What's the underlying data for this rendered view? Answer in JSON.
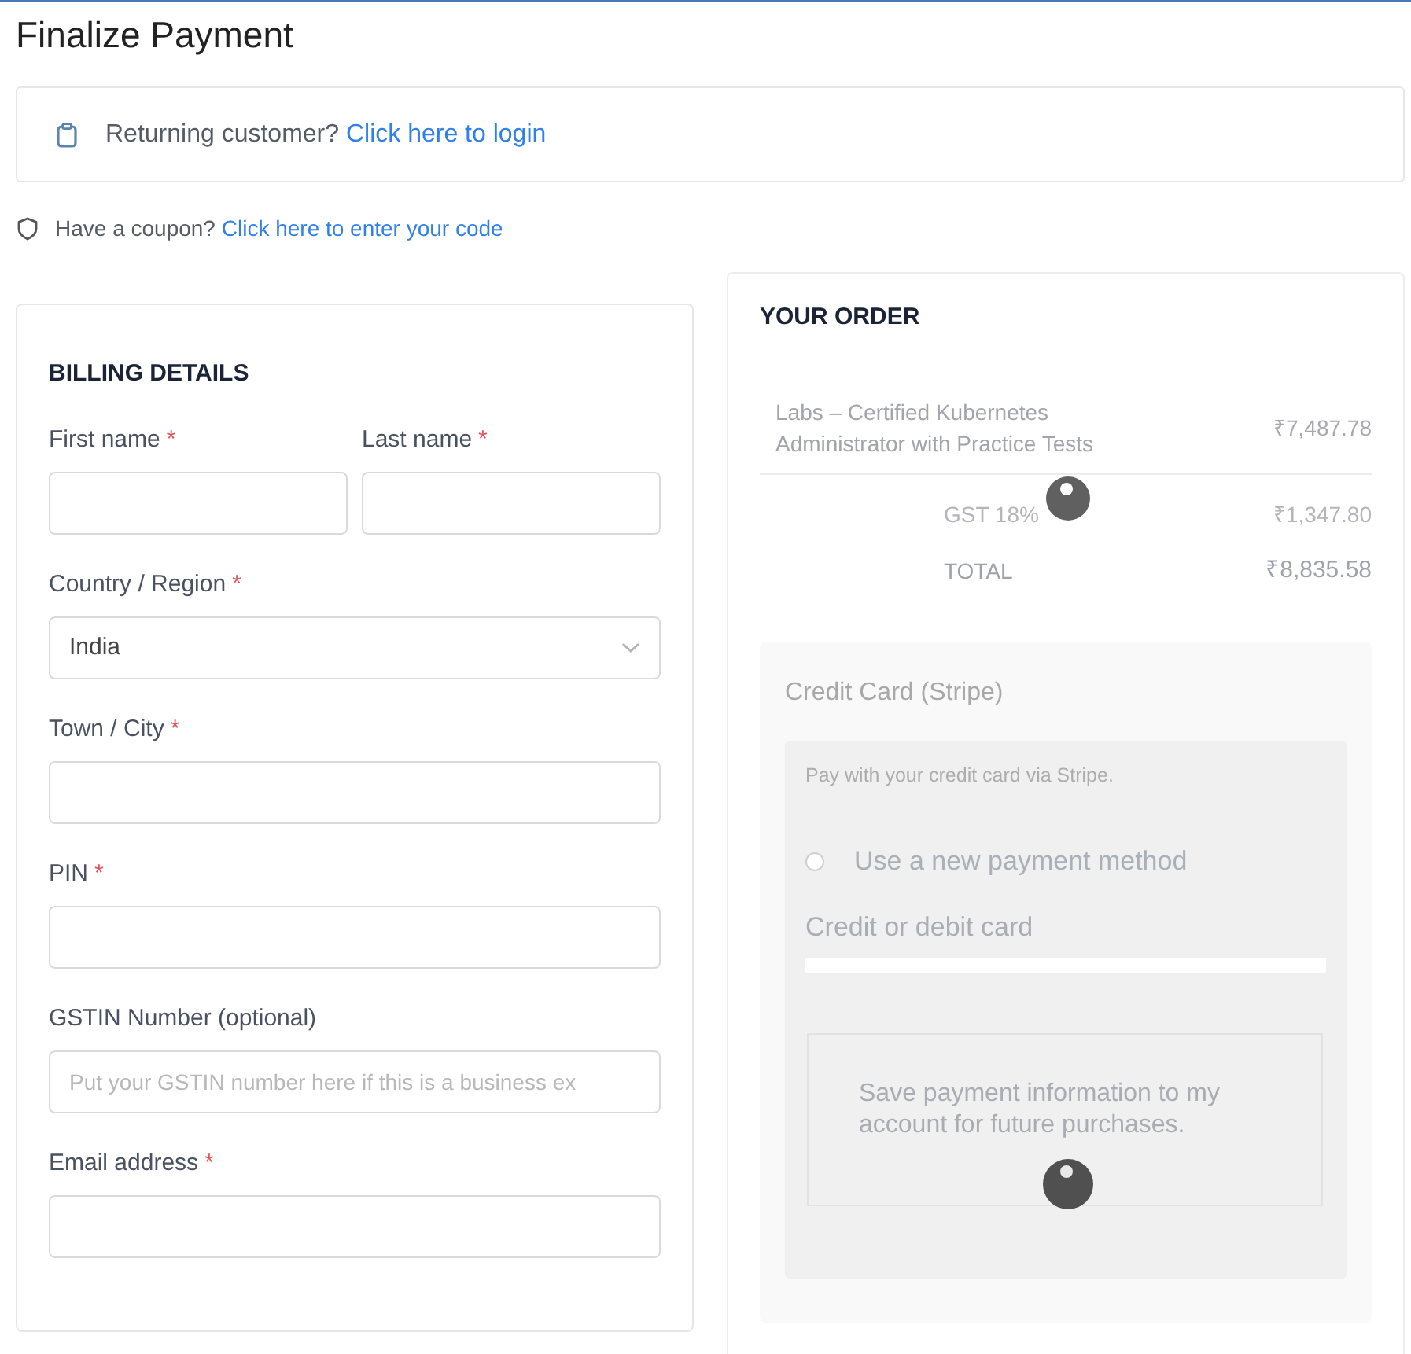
{
  "page": {
    "title": "Finalize Payment"
  },
  "login_notice": {
    "text": "Returning customer?",
    "link": "Click here to login"
  },
  "coupon_notice": {
    "text": "Have a coupon?",
    "link": "Click here to enter your code"
  },
  "billing": {
    "heading": "BILLING DETAILS",
    "required_mark": "*",
    "rows": [
      {
        "fields": [
          {
            "kind": "text",
            "label": "First name",
            "required": true
          },
          {
            "kind": "text",
            "label": "Last name",
            "required": true
          }
        ]
      },
      {
        "fields": [
          {
            "kind": "select",
            "label": "Country / Region",
            "required": true,
            "value": "India"
          }
        ]
      },
      {
        "fields": [
          {
            "kind": "text",
            "label": "Town / City",
            "required": true
          }
        ]
      },
      {
        "fields": [
          {
            "kind": "text",
            "label": "PIN",
            "required": true
          }
        ]
      },
      {
        "fields": [
          {
            "kind": "text",
            "label": "GSTIN Number (optional)",
            "required": false,
            "placeholder": "Put your GSTIN number here if this is a business ex"
          }
        ]
      },
      {
        "fields": [
          {
            "kind": "text",
            "label": "Email address",
            "required": true
          }
        ]
      }
    ]
  },
  "order": {
    "heading": "YOUR ORDER",
    "items": [
      {
        "name": "Labs – Certified Kubernetes Administrator with Practice Tests",
        "price": "₹7,487.78"
      }
    ],
    "totals": [
      {
        "kind": "tax",
        "label": "GST 18%",
        "amount": "₹1,347.80"
      },
      {
        "kind": "total",
        "label": "TOTAL",
        "amount": "₹8,835.58"
      }
    ]
  },
  "payment": {
    "method": "Credit Card (Stripe)",
    "description": "Pay with your credit card via Stripe.",
    "options": [
      {
        "label": "Use a new payment method",
        "selected": false
      }
    ],
    "card_label": "Credit or debit card",
    "save_info": "Save payment information to my account for future purchases."
  }
}
